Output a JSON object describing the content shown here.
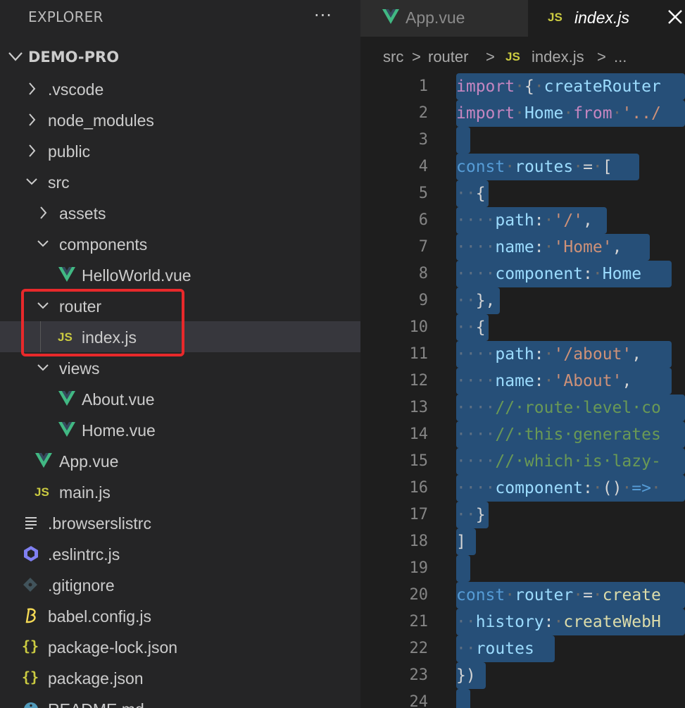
{
  "sidebar": {
    "title": "EXPLORER",
    "more_icon": "···",
    "project": "DEMO-PRO",
    "items": [
      {
        "label": ".vscode",
        "kind": "folder",
        "expanded": false,
        "depth": 0
      },
      {
        "label": "node_modules",
        "kind": "folder",
        "expanded": false,
        "depth": 0
      },
      {
        "label": "public",
        "kind": "folder",
        "expanded": false,
        "depth": 0
      },
      {
        "label": "src",
        "kind": "folder",
        "expanded": true,
        "depth": 0
      },
      {
        "label": "assets",
        "kind": "folder",
        "expanded": false,
        "depth": 1
      },
      {
        "label": "components",
        "kind": "folder",
        "expanded": true,
        "depth": 1
      },
      {
        "label": "HelloWorld.vue",
        "kind": "vue",
        "depth": 2
      },
      {
        "label": "router",
        "kind": "folder",
        "expanded": true,
        "depth": 1
      },
      {
        "label": "index.js",
        "kind": "js",
        "depth": 2,
        "selected": true
      },
      {
        "label": "views",
        "kind": "folder",
        "expanded": true,
        "depth": 1
      },
      {
        "label": "About.vue",
        "kind": "vue",
        "depth": 2
      },
      {
        "label": "Home.vue",
        "kind": "vue",
        "depth": 2
      },
      {
        "label": "App.vue",
        "kind": "vue",
        "depth": 1
      },
      {
        "label": "main.js",
        "kind": "js",
        "depth": 1
      },
      {
        "label": ".browserslistrc",
        "kind": "list",
        "depth": 0
      },
      {
        "label": ".eslintrc.js",
        "kind": "eslint",
        "depth": 0
      },
      {
        "label": ".gitignore",
        "kind": "git",
        "depth": 0
      },
      {
        "label": "babel.config.js",
        "kind": "babel",
        "depth": 0
      },
      {
        "label": "package-lock.json",
        "kind": "json",
        "depth": 0
      },
      {
        "label": "package.json",
        "kind": "json",
        "depth": 0
      },
      {
        "label": "README.md",
        "kind": "info",
        "depth": 0
      }
    ],
    "icon_names": {
      "vue": "vue-icon",
      "js": "js-icon",
      "list": "list-icon",
      "eslint": "eslint-icon",
      "git": "git-icon",
      "babel": "babel-icon",
      "json": "json-icon",
      "info": "info-icon"
    },
    "js_badge": "JS",
    "json_badge": "{}"
  },
  "tabs": [
    {
      "label": "App.vue",
      "icon": "vue-icon",
      "active": false
    },
    {
      "label": "index.js",
      "icon": "js-icon",
      "active": true,
      "badge": "JS"
    }
  ],
  "breadcrumb": {
    "parts": [
      "src",
      ">",
      "router",
      ">",
      "JS",
      "index.js",
      ">",
      "..."
    ]
  },
  "editor": {
    "lines": [
      {
        "n": "1",
        "sel": 325,
        "tokens": [
          [
            "kw",
            "import"
          ],
          [
            "ws",
            "·"
          ],
          [
            "pun",
            "{"
          ],
          [
            "ws",
            "·"
          ],
          [
            "var",
            "createRouter"
          ]
        ]
      },
      {
        "n": "2",
        "sel": 325,
        "tokens": [
          [
            "kw",
            "import"
          ],
          [
            "ws",
            "·"
          ],
          [
            "var",
            "Home"
          ],
          [
            "ws",
            "·"
          ],
          [
            "kw",
            "from"
          ],
          [
            "ws",
            "·"
          ],
          [
            "str",
            "'../"
          ]
        ]
      },
      {
        "n": "3",
        "sel": 20,
        "tokens": []
      },
      {
        "n": "4",
        "sel": 260,
        "tokens": [
          [
            "kw2",
            "const"
          ],
          [
            "ws",
            "·"
          ],
          [
            "var",
            "routes"
          ],
          [
            "ws",
            "·"
          ],
          [
            "pun",
            "="
          ],
          [
            "ws",
            "·"
          ],
          [
            "pun",
            "["
          ]
        ]
      },
      {
        "n": "5",
        "sel": 46,
        "tokens": [
          [
            "indent-dots",
            "··"
          ],
          [
            "pun",
            "{"
          ]
        ]
      },
      {
        "n": "6",
        "sel": 214,
        "tokens": [
          [
            "indent-dots",
            "····"
          ],
          [
            "var",
            "path"
          ],
          [
            "pun",
            ":"
          ],
          [
            "ws",
            "·"
          ],
          [
            "str",
            "'/'"
          ],
          [
            "pun",
            ","
          ]
        ]
      },
      {
        "n": "7",
        "sel": 275,
        "tokens": [
          [
            "indent-dots",
            "····"
          ],
          [
            "var",
            "name"
          ],
          [
            "pun",
            ":"
          ],
          [
            "ws",
            "·"
          ],
          [
            "str",
            "'Home'"
          ],
          [
            "pun",
            ","
          ]
        ]
      },
      {
        "n": "8",
        "sel": 306,
        "tokens": [
          [
            "indent-dots",
            "····"
          ],
          [
            "var",
            "component"
          ],
          [
            "pun",
            ":"
          ],
          [
            "ws",
            "·"
          ],
          [
            "var",
            "Home"
          ]
        ]
      },
      {
        "n": "9",
        "sel": 62,
        "tokens": [
          [
            "indent-dots",
            "··"
          ],
          [
            "pun",
            "},"
          ]
        ]
      },
      {
        "n": "10",
        "sel": 46,
        "tokens": [
          [
            "indent-dots",
            "··"
          ],
          [
            "pun",
            "{"
          ]
        ]
      },
      {
        "n": "11",
        "sel": 306,
        "tokens": [
          [
            "indent-dots",
            "····"
          ],
          [
            "var",
            "path"
          ],
          [
            "pun",
            ":"
          ],
          [
            "ws",
            "·"
          ],
          [
            "str",
            "'/about'"
          ],
          [
            "pun",
            ","
          ]
        ]
      },
      {
        "n": "12",
        "sel": 306,
        "tokens": [
          [
            "indent-dots",
            "····"
          ],
          [
            "var",
            "name"
          ],
          [
            "pun",
            ":"
          ],
          [
            "ws",
            "·"
          ],
          [
            "str",
            "'About'"
          ],
          [
            "pun",
            ","
          ]
        ]
      },
      {
        "n": "13",
        "sel": 325,
        "tokens": [
          [
            "indent-dots",
            "····"
          ],
          [
            "cm",
            "//·route·level·co"
          ]
        ]
      },
      {
        "n": "14",
        "sel": 325,
        "tokens": [
          [
            "indent-dots",
            "····"
          ],
          [
            "cm",
            "//·this·generates"
          ]
        ]
      },
      {
        "n": "15",
        "sel": 325,
        "tokens": [
          [
            "indent-dots",
            "····"
          ],
          [
            "cm",
            "//·which·is·lazy-"
          ]
        ]
      },
      {
        "n": "16",
        "sel": 325,
        "tokens": [
          [
            "indent-dots",
            "····"
          ],
          [
            "var",
            "component"
          ],
          [
            "pun",
            ":"
          ],
          [
            "ws",
            "·"
          ],
          [
            "pun",
            "()"
          ],
          [
            "ws",
            "·"
          ],
          [
            "kw2",
            "=>"
          ],
          [
            "ws",
            "·"
          ]
        ]
      },
      {
        "n": "17",
        "sel": 46,
        "tokens": [
          [
            "indent-dots",
            "··"
          ],
          [
            "pun",
            "}"
          ]
        ]
      },
      {
        "n": "18",
        "sel": 28,
        "tokens": [
          [
            "pun",
            "]"
          ]
        ]
      },
      {
        "n": "19",
        "sel": 20,
        "tokens": []
      },
      {
        "n": "20",
        "sel": 325,
        "tokens": [
          [
            "kw2",
            "const"
          ],
          [
            "ws",
            "·"
          ],
          [
            "var",
            "router"
          ],
          [
            "ws",
            "·"
          ],
          [
            "pun",
            "="
          ],
          [
            "ws",
            "·"
          ],
          [
            "fn",
            "create"
          ]
        ]
      },
      {
        "n": "21",
        "sel": 325,
        "tokens": [
          [
            "indent-dots",
            "··"
          ],
          [
            "var",
            "history"
          ],
          [
            "pun",
            ":"
          ],
          [
            "ws",
            "·"
          ],
          [
            "fn",
            "createWebH"
          ]
        ]
      },
      {
        "n": "22",
        "sel": 140,
        "tokens": [
          [
            "indent-dots",
            "··"
          ],
          [
            "var",
            "routes"
          ]
        ]
      },
      {
        "n": "23",
        "sel": 42,
        "tokens": [
          [
            "pun",
            "})"
          ]
        ]
      },
      {
        "n": "24",
        "sel": 20,
        "tokens": []
      }
    ]
  },
  "colors": {
    "accent_vue": "#41b883",
    "js_yellow": "#cbcb41",
    "selection": "#264f78",
    "highlight_box": "#e8292b"
  }
}
